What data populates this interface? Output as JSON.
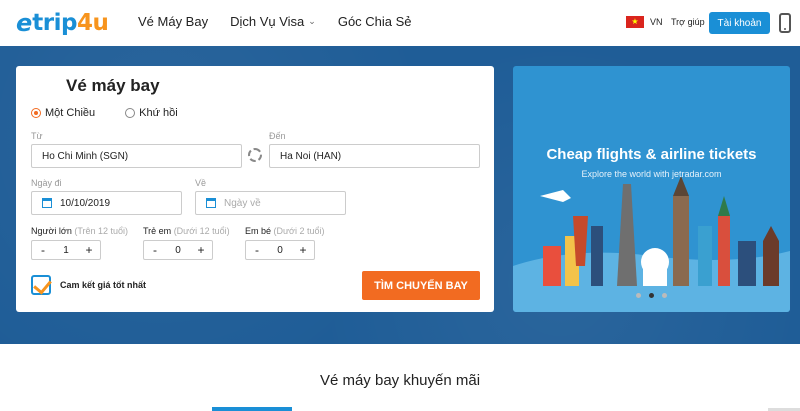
{
  "header": {
    "logo": {
      "prefix": "e",
      "name_main": "trip",
      "name_accent": "4u"
    },
    "nav": [
      {
        "label": "Vé Máy Bay"
      },
      {
        "label": "Dịch Vụ Visa"
      },
      {
        "label": "Góc Chia Sẻ"
      }
    ],
    "language": "VN",
    "help": "Trợ giúp",
    "account": "Tài khoản"
  },
  "search": {
    "title": "Vé máy bay",
    "trip_types": [
      {
        "label": "Một Chiều",
        "selected": true
      },
      {
        "label": "Khứ hồi",
        "selected": false
      }
    ],
    "from_label": "Từ",
    "from_value": "Ho Chi Minh (SGN)",
    "to_label": "Đến",
    "to_value": "Ha Noi (HAN)",
    "depart_label": "Ngày đi",
    "depart_value": "10/10/2019",
    "return_label": "Về",
    "return_placeholder": "Ngày về",
    "passengers": [
      {
        "label": "Người lớn",
        "sub": "(Trên 12 tuổi)",
        "value": "1"
      },
      {
        "label": "Trẻ em",
        "sub": "(Dưới 12 tuổi)",
        "value": "0"
      },
      {
        "label": "Em bé",
        "sub": "(Dưới 2 tuổi)",
        "value": "0"
      }
    ],
    "minus": "-",
    "plus": "+",
    "guarantee": "Cam kết giá tốt nhất",
    "submit": "TÌM CHUYẾN BAY"
  },
  "banner": {
    "title": "Cheap flights & airline tickets",
    "subtitle": "Explore the world with jetradar.com"
  },
  "promo": {
    "title": "Vé máy bay khuyến mãi"
  },
  "colors": {
    "brand": "#1a8fd6",
    "accent": "#f26b21",
    "hero_bg": "#1f5d97"
  }
}
